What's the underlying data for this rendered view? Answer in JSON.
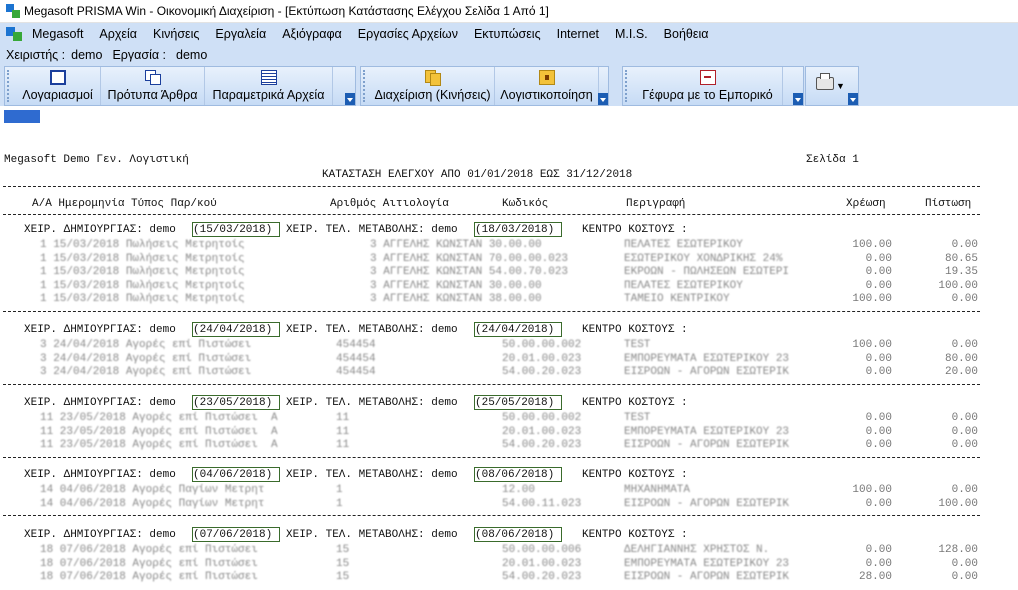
{
  "window": {
    "title": "Megasoft PRISMA Win - Οικονομική Διαχείριση - [Εκτύπωση Κατάστασης Ελέγχου Σελίδα 1 Από 1]"
  },
  "menu": [
    "Megasoft",
    "Αρχεία",
    "Κινήσεις",
    "Εργαλεία",
    "Αξιόγραφα",
    "Εργασίες Αρχείων",
    "Εκτυπώσεις",
    "Internet",
    "M.I.S.",
    "Βοήθεια"
  ],
  "userbar": {
    "user_label": "Χειριστής :",
    "user_value": "demo",
    "work_label": "Εργασία :",
    "work_value": "demo"
  },
  "toolbar": {
    "accounts": "Λογαριασμοί",
    "templates": "Πρότυπα Άρθρα",
    "param_files": "Παραμετρικά Αρχεία",
    "manage": "Διαχείριση (Κινήσεις)",
    "accounting": "Λογιστικοποίηση",
    "bridge": "Γέφυρα με το Εμπορικό"
  },
  "report": {
    "company": "Megasoft Demo Γεν. Λογιστική",
    "page": "Σελίδα 1",
    "title": "ΚΑΤΑΣΤΑΣΗ ΕΛΕΓΧΟΥ ΑΠΟ 01/01/2018 ΕΩΣ 31/12/2018",
    "col_aa": "Α/Α Ημερομηνία Τύπος Παρ/κού",
    "col_num": "Αριθμός Αιτιολογία",
    "col_code": "Κωδικός",
    "col_desc": "Περιγραφή",
    "col_debit": "Χρέωση",
    "col_credit": "Πίστωση",
    "create_label": "ΧΕΙΡ. ΔΗΜΙΟΥΡΓΙΑΣ: demo",
    "modify_label": "ΧΕΙΡ. ΤΕΛ. ΜΕΤΑΒΟΛΗΣ: demo",
    "cost_center": "ΚΕΝΤΡΟ ΚΟΣΤΟΥΣ :",
    "groups": [
      {
        "created": "(15/03/2018)",
        "modified": "(18/03/2018)",
        "rows": [
          {
            "left": "1 15/03/2018 Πωλήσεις Μετρητοίς",
            "mid": "3 ΑΓΓΕΛΗΣ ΚΩΝΣΤΑΝ 30.00.00",
            "desc": "ΠΕΛΑΤΕΣ ΕΣΩΤΕΡΙΚΟΥ",
            "debit": "100.00",
            "credit": "0.00"
          },
          {
            "left": "1 15/03/2018 Πωλήσεις Μετρητοίς",
            "mid": "3 ΑΓΓΕΛΗΣ ΚΩΝΣΤΑΝ 70.00.00.023",
            "desc": "ΕΣΩΤΕΡΙΚΟΥ ΧΟΝΔΡΙΚΗΣ 24%",
            "debit": "0.00",
            "credit": "80.65"
          },
          {
            "left": "1 15/03/2018 Πωλήσεις Μετρητοίς",
            "mid": "3 ΑΓΓΕΛΗΣ ΚΩΝΣΤΑΝ 54.00.70.023",
            "desc": "ΕΚΡΟΩΝ - ΠΩΛΗΣΕΩΝ ΕΣΩΤΕΡΙ",
            "debit": "0.00",
            "credit": "19.35"
          },
          {
            "left": "1 15/03/2018 Πωλήσεις Μετρητοίς",
            "mid": "3 ΑΓΓΕΛΗΣ ΚΩΝΣΤΑΝ 30.00.00",
            "desc": "ΠΕΛΑΤΕΣ ΕΣΩΤΕΡΙΚΟΥ",
            "debit": "0.00",
            "credit": "100.00"
          },
          {
            "left": "1 15/03/2018 Πωλήσεις Μετρητοίς",
            "mid": "3 ΑΓΓΕΛΗΣ ΚΩΝΣΤΑΝ 38.00.00",
            "desc": "ΤΑΜΕΙΟ ΚΕΝΤΡΙΚΟΥ",
            "debit": "100.00",
            "credit": "0.00"
          }
        ]
      },
      {
        "created": "(24/04/2018)",
        "modified": "(24/04/2018)",
        "rows": [
          {
            "left": "3 24/04/2018 Αγορές επί Πιστώσει",
            "mid": "454454",
            "desc": "TEST",
            "debit": "100.00",
            "credit": "0.00",
            "code": "50.00.00.002"
          },
          {
            "left": "3 24/04/2018 Αγορές επί Πιστώσει",
            "mid": "454454",
            "desc": "ΕΜΠΟΡΕΥΜΑΤΑ ΕΣΩΤΕΡΙΚΟΥ 23",
            "debit": "0.00",
            "credit": "80.00",
            "code": "20.01.00.023"
          },
          {
            "left": "3 24/04/2018 Αγορές επί Πιστώσει",
            "mid": "454454",
            "desc": "ΕΙΣΡΟΩΝ - ΑΓΟΡΩΝ ΕΣΩΤΕΡΙΚ",
            "debit": "0.00",
            "credit": "20.00",
            "code": "54.00.20.023"
          }
        ]
      },
      {
        "created": "(23/05/2018)",
        "modified": "(25/05/2018)",
        "rows": [
          {
            "left": "11 23/05/2018 Αγορές επί Πιστώσει  Α",
            "mid": "11",
            "desc": "TEST",
            "debit": "0.00",
            "credit": "0.00",
            "code": "50.00.00.002"
          },
          {
            "left": "11 23/05/2018 Αγορές επί Πιστώσει  Α",
            "mid": "11",
            "desc": "ΕΜΠΟΡΕΥΜΑΤΑ ΕΣΩΤΕΡΙΚΟΥ 23",
            "debit": "0.00",
            "credit": "0.00",
            "code": "20.01.00.023"
          },
          {
            "left": "11 23/05/2018 Αγορές επί Πιστώσει  Α",
            "mid": "11",
            "desc": "ΕΙΣΡΟΩΝ - ΑΓΟΡΩΝ ΕΣΩΤΕΡΙΚ",
            "debit": "0.00",
            "credit": "0.00",
            "code": "54.00.20.023"
          }
        ]
      },
      {
        "created": "(04/06/2018)",
        "modified": "(08/06/2018)",
        "rows": [
          {
            "left": "14 04/06/2018 Αγορές Παγίων Μετρητ",
            "mid": "1",
            "desc": "ΜΗΧΑΝΗΜΑΤΑ",
            "debit": "100.00",
            "credit": "0.00",
            "code": "12.00"
          },
          {
            "left": "14 04/06/2018 Αγορές Παγίων Μετρητ",
            "mid": "1",
            "desc": "ΕΙΣΡΟΩΝ - ΑΓΟΡΩΝ ΕΣΩΤΕΡΙΚ",
            "debit": "0.00",
            "credit": "100.00",
            "code": "54.00.11.023"
          }
        ]
      },
      {
        "created": "(07/06/2018)",
        "modified": "(08/06/2018)",
        "rows": [
          {
            "left": "18 07/06/2018 Αγορές επί Πιστώσει",
            "mid": "15",
            "desc": "ΔΕΛΗΓΙΑΝΝΗΣ ΧΡΗΣΤΟΣ Ν.",
            "debit": "0.00",
            "credit": "128.00",
            "code": "50.00.00.006"
          },
          {
            "left": "18 07/06/2018 Αγορές επί Πιστώσει",
            "mid": "15",
            "desc": "ΕΜΠΟΡΕΥΜΑΤΑ ΕΣΩΤΕΡΙΚΟΥ 23",
            "debit": "0.00",
            "credit": "0.00",
            "code": "20.01.00.023"
          },
          {
            "left": "18 07/06/2018 Αγορές επί Πιστώσει",
            "mid": "15",
            "desc": "ΕΙΣΡΟΩΝ - ΑΓΟΡΩΝ ΕΣΩΤΕΡΙΚ",
            "debit": "28.00",
            "credit": "0.00",
            "code": "54.00.20.023"
          }
        ]
      }
    ]
  }
}
